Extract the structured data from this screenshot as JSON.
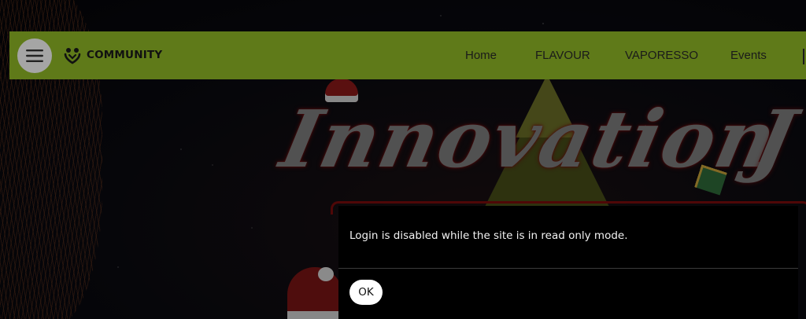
{
  "colors": {
    "navbar_bg": "#5f7a19",
    "menu_button_bg": "#a5a5a5",
    "dialog_bg": "#000000",
    "ok_button_bg": "#ffffff"
  },
  "header": {
    "brand": "COMMUNITY",
    "menu_icon": "hamburger-menu-icon",
    "logo_icon": "community-heart-logo-icon",
    "nav": [
      {
        "label": "Home"
      },
      {
        "label": "FLAVOUR"
      },
      {
        "label": "VAPORESSO"
      },
      {
        "label": "Events"
      }
    ]
  },
  "banner": {
    "title": "Innovation",
    "title_continued": "J"
  },
  "dialog": {
    "message": "Login is disabled while the site is in read only mode.",
    "ok_label": "OK"
  }
}
